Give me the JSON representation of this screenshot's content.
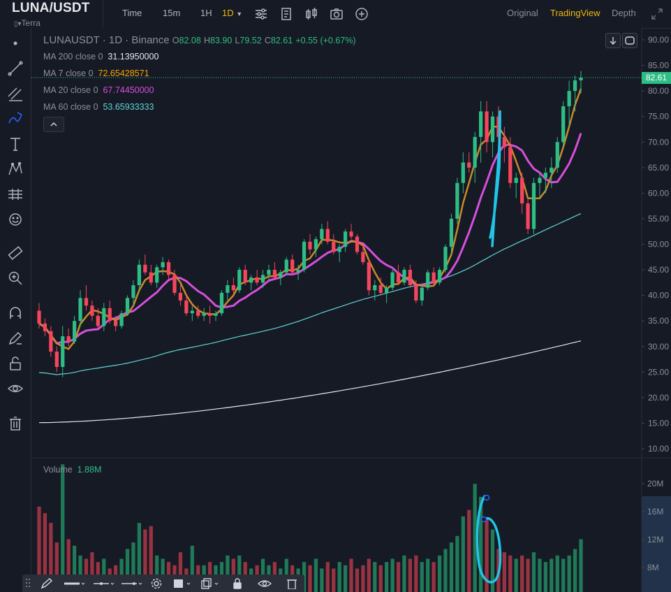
{
  "header": {
    "symbol": "LUNA/USDT",
    "subtitle": "Terra",
    "intervals": [
      "Time",
      "15m",
      "1H",
      "1D"
    ],
    "active_interval": "1D",
    "view_modes": [
      "Original",
      "TradingView",
      "Depth"
    ],
    "active_view": "TradingView"
  },
  "legend": {
    "pair": "LUNAUSDT · 1D · Binance",
    "open_label": "O",
    "open": "82.08",
    "high_label": "H",
    "high": "83.90",
    "low_label": "L",
    "low": "79.52",
    "close_label": "C",
    "close": "82.61",
    "change": "+0.55 (+0.67%)",
    "ma": [
      {
        "label": "MA 200 close 0",
        "value": "31.13950000",
        "color": "#e6e8ec"
      },
      {
        "label": "MA 7 close 0",
        "value": "72.65428571",
        "color": "#f7a600"
      },
      {
        "label": "MA 20 close 0",
        "value": "67.74450000",
        "color": "#d64fdc"
      },
      {
        "label": "MA 60 close 0",
        "value": "53.65933333",
        "color": "#5fd6d2"
      }
    ]
  },
  "price_tag": "82.61",
  "volume": {
    "label": "Volume",
    "value": "1.88M"
  },
  "colors": {
    "up": "#2ebd85",
    "down": "#f6465d",
    "bg": "#161a25",
    "accent": "#f0b90b"
  },
  "chart_data": {
    "type": "candlestick",
    "price_axis": {
      "ticks": [
        "90.00",
        "85.00",
        "80.00",
        "75.00",
        "70.00",
        "65.00",
        "60.00",
        "55.00",
        "50.00",
        "45.00",
        "40.00",
        "35.00",
        "30.00",
        "25.00",
        "20.00",
        "15.00",
        "10.00"
      ],
      "ylim": [
        8,
        92
      ]
    },
    "volume_axis": {
      "ticks": [
        "20M",
        "16M",
        "12M",
        "8M"
      ]
    },
    "candles": [
      [
        37,
        38.5,
        33.5,
        34.5
      ],
      [
        34.5,
        35.5,
        32,
        33
      ],
      [
        33,
        34,
        28,
        29
      ],
      [
        29,
        30,
        25,
        26
      ],
      [
        26,
        34,
        24,
        32
      ],
      [
        32,
        33.5,
        30,
        31
      ],
      [
        31,
        36,
        30.5,
        35
      ],
      [
        35,
        41,
        34,
        39.5
      ],
      [
        39.5,
        42,
        37,
        38
      ],
      [
        38,
        39,
        35,
        36
      ],
      [
        36,
        37.5,
        33.5,
        34
      ],
      [
        34,
        38.5,
        33,
        37.5
      ],
      [
        37.5,
        39,
        34.5,
        35
      ],
      [
        35,
        36,
        33,
        34
      ],
      [
        34,
        37,
        33.5,
        36.5
      ],
      [
        36.5,
        40,
        36,
        39.5
      ],
      [
        39.5,
        43,
        38,
        42
      ],
      [
        42,
        47,
        41,
        46
      ],
      [
        46,
        48,
        44,
        44.5
      ],
      [
        44.5,
        46,
        42,
        42.5
      ],
      [
        42.5,
        46,
        41.5,
        45.5
      ],
      [
        45.5,
        47.5,
        44,
        46.5
      ],
      [
        46.5,
        47,
        43,
        44
      ],
      [
        44,
        45,
        40,
        40.5
      ],
      [
        40.5,
        42,
        38,
        39
      ],
      [
        39,
        40,
        36,
        36.5
      ],
      [
        36.5,
        38,
        35,
        37
      ],
      [
        37,
        38,
        35.5,
        36
      ],
      [
        36,
        37.5,
        35,
        36.5
      ],
      [
        36.5,
        38,
        34.5,
        36
      ],
      [
        36,
        37,
        35,
        36.5
      ],
      [
        36.5,
        41,
        36,
        40.5
      ],
      [
        40.5,
        43,
        39,
        42
      ],
      [
        42,
        43.5,
        40,
        41
      ],
      [
        41,
        45.5,
        40.5,
        45
      ],
      [
        45,
        46,
        42,
        42.5
      ],
      [
        42.5,
        44,
        41,
        43.5
      ],
      [
        43.5,
        45,
        42,
        42.5
      ],
      [
        42.5,
        45,
        41.5,
        44
      ],
      [
        44,
        46,
        43,
        45
      ],
      [
        45,
        46.5,
        43,
        43.5
      ],
      [
        43.5,
        45,
        42,
        44.5
      ],
      [
        44.5,
        47.5,
        44,
        47
      ],
      [
        47,
        48,
        44,
        44.5
      ],
      [
        44.5,
        46,
        43,
        45
      ],
      [
        45,
        51,
        44.5,
        50.5
      ],
      [
        50.5,
        52,
        48,
        49
      ],
      [
        49,
        51.5,
        47.5,
        51
      ],
      [
        51,
        54,
        50,
        53
      ],
      [
        53,
        54.5,
        50,
        50.5
      ],
      [
        50.5,
        52,
        48,
        48.5
      ],
      [
        48.5,
        50,
        46.5,
        49.5
      ],
      [
        49.5,
        53,
        48.5,
        52.5
      ],
      [
        52.5,
        54,
        51,
        51.5
      ],
      [
        51.5,
        52,
        48,
        48.5
      ],
      [
        48.5,
        50,
        46,
        46.5
      ],
      [
        46.5,
        47,
        40,
        41
      ],
      [
        41,
        43,
        39,
        42
      ],
      [
        42,
        43.5,
        40,
        40.5
      ],
      [
        40.5,
        42,
        38.5,
        41.5
      ],
      [
        41.5,
        45,
        41,
        44.5
      ],
      [
        44.5,
        46,
        42,
        42.5
      ],
      [
        42.5,
        45.5,
        42,
        45
      ],
      [
        45,
        46,
        41.5,
        42
      ],
      [
        42,
        43,
        38.5,
        39
      ],
      [
        39,
        42,
        38,
        41.5
      ],
      [
        41.5,
        45,
        41,
        44.5
      ],
      [
        44.5,
        45.5,
        42,
        42.5
      ],
      [
        42.5,
        45.5,
        42,
        45
      ],
      [
        45,
        50,
        44.5,
        49.5
      ],
      [
        49.5,
        56,
        48,
        55
      ],
      [
        55,
        63,
        54,
        62
      ],
      [
        62,
        68,
        60,
        66
      ],
      [
        66,
        68,
        64,
        65
      ],
      [
        65,
        72,
        62,
        71
      ],
      [
        71,
        78,
        66,
        76
      ],
      [
        76,
        78,
        68,
        70
      ],
      [
        70,
        76,
        67,
        75
      ],
      [
        75,
        77,
        69,
        71
      ],
      [
        71,
        73,
        66,
        69
      ],
      [
        69,
        71,
        61,
        62
      ],
      [
        62,
        64,
        59,
        63
      ],
      [
        63,
        64,
        56,
        58
      ],
      [
        58,
        59,
        52,
        53
      ],
      [
        53,
        63,
        52,
        62
      ],
      [
        62,
        64,
        59,
        63
      ],
      [
        63,
        65,
        60,
        64
      ],
      [
        64,
        67,
        61,
        65
      ],
      [
        65,
        71,
        64,
        70
      ],
      [
        70,
        78,
        69,
        77
      ],
      [
        77,
        82,
        73,
        80
      ],
      [
        80,
        83,
        76,
        82.08
      ],
      [
        82.08,
        83.9,
        79.52,
        82.61
      ]
    ],
    "volumes": [
      14.5,
      13.5,
      12,
      9,
      21,
      9.5,
      8.5,
      7,
      6.5,
      7.5,
      6,
      6.5,
      5,
      5.5,
      6.5,
      8,
      9,
      12,
      11,
      11.5,
      7,
      6.5,
      6,
      5.5,
      7.5,
      5,
      8.5,
      5.5,
      5.5,
      6,
      5.5,
      6,
      7,
      6.5,
      7,
      6,
      5,
      5.5,
      6.5,
      5.5,
      6,
      5,
      6.5,
      5.5,
      5,
      6,
      5.5,
      6.5,
      5,
      6,
      5,
      6,
      5.5,
      6.5,
      5,
      5.5,
      6.5,
      6,
      5.5,
      6,
      6.5,
      6,
      7,
      6.5,
      7,
      6,
      6.5,
      6,
      7,
      8,
      9,
      10,
      13,
      14,
      18,
      16,
      12.5,
      11,
      8,
      7.5,
      7,
      6.5,
      7,
      6.5,
      7.5,
      6.5,
      6,
      6.5,
      7,
      6.5,
      7,
      8,
      9.5
    ],
    "moving_averages": [
      {
        "name": "MA 200",
        "start": 15.1,
        "end": 31.1
      },
      {
        "name": "MA 60",
        "start": 23.2,
        "end": 53.7
      },
      {
        "name": "MA 20",
        "end": 67.7
      },
      {
        "name": "MA 7",
        "end": 72.7
      }
    ]
  }
}
